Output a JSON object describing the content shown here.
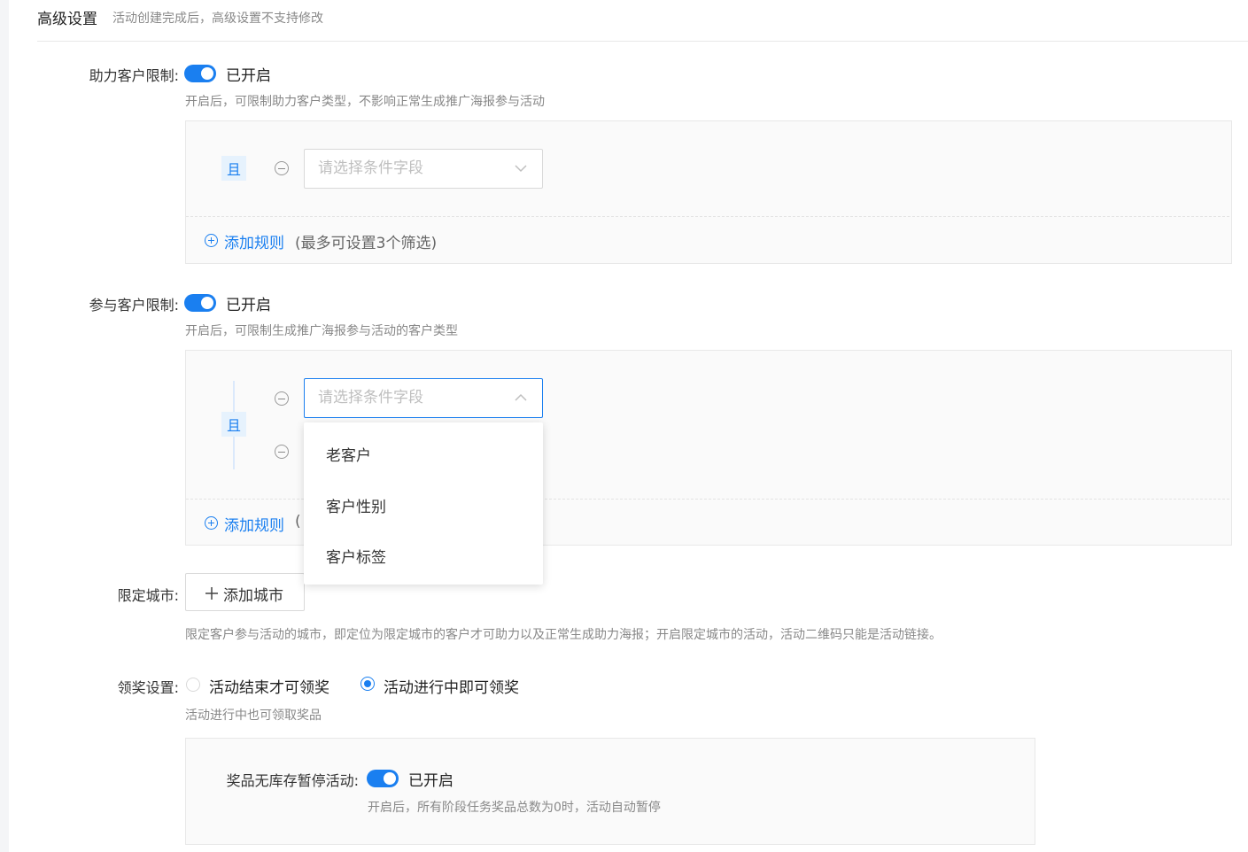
{
  "section": {
    "title": "高级设置",
    "note": "活动创建完成后，高级设置不支持修改"
  },
  "assist_limit": {
    "label": "助力客户限制:",
    "state": "已开启",
    "hint": "开启后，可限制助力客户类型，不影响正常生成推广海报参与活动",
    "logic": "且",
    "select_placeholder": "请选择条件字段",
    "add_rule": "添加规则",
    "add_rule_note": "(最多可设置3个筛选)"
  },
  "join_limit": {
    "label": "参与客户限制:",
    "state": "已开启",
    "hint": "开启后，可限制生成推广海报参与活动的客户类型",
    "logic": "且",
    "select_placeholder": "请选择条件字段",
    "add_rule": "添加规则",
    "add_rule_note_visible": "(",
    "dropdown_options": [
      "老客户",
      "客户性别",
      "客户标签"
    ]
  },
  "city": {
    "label": "限定城市:",
    "button": "添加城市",
    "hint": "限定客户参与活动的城市，即定位为限定城市的客户才可助力以及正常生成助力海报；开启限定城市的活动，活动二维码只能是活动链接。"
  },
  "prize": {
    "label": "领奖设置:",
    "options": [
      "活动结束才可领奖",
      "活动进行中即可领奖"
    ],
    "selected_index": 1,
    "hint": "活动进行中也可领取奖品",
    "pause": {
      "label": "奖品无库存暂停活动:",
      "state": "已开启",
      "hint": "开启后，所有阶段任务奖品总数为0时，活动自动暂停"
    }
  },
  "colors": {
    "primary": "#1a7ff0",
    "hint_text": "#888888",
    "panel_bg": "#fafafa"
  }
}
